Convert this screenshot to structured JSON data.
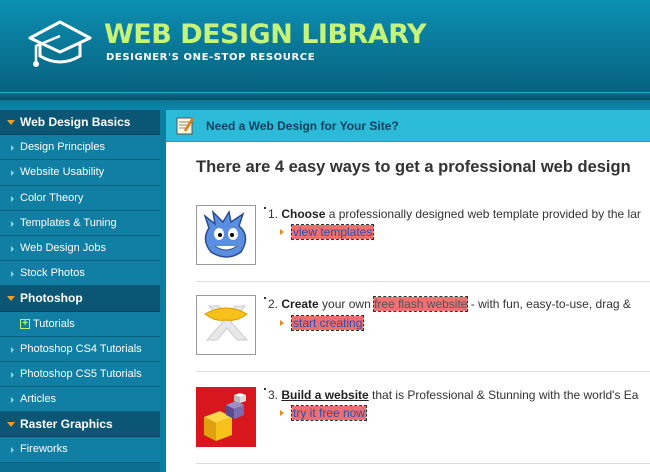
{
  "header": {
    "title": "WEB DESIGN LIBRARY",
    "tagline": "DESIGNER'S ONE-STOP RESOURCE"
  },
  "sidebar": {
    "sections": [
      {
        "label": "Web Design Basics",
        "items": [
          "Design Principles",
          "Website Usability",
          "Color Theory",
          "Templates & Tuning",
          "Web Design Jobs",
          "Stock Photos"
        ]
      },
      {
        "label": "Photoshop",
        "items": [
          "Tutorials",
          "Photoshop CS4 Tutorials",
          "Photoshop CS5 Tutorials",
          "Articles"
        ]
      },
      {
        "label": "Raster Graphics",
        "items": [
          "Fireworks"
        ]
      }
    ]
  },
  "banner": {
    "text": "Need a Web Design for Your Site?"
  },
  "main": {
    "heading": "There are 4 easy ways to get a professional web design",
    "steps": [
      {
        "num": "1.",
        "lead": "Choose",
        "rest": " a professionally designed web template provided by the lar",
        "cta": "view templates"
      },
      {
        "num": "2.",
        "lead": "Create",
        "mid": " your own ",
        "highlight": "free flash website",
        "rest": " - with fun, easy-to-use, drag &",
        "cta": "start creating"
      },
      {
        "num": "3.",
        "lead": "Build a website",
        "rest": " that is Professional & Stunning with the world's Ea",
        "cta": "try it free now"
      }
    ]
  },
  "colors": {
    "header": "#0a7898",
    "logo_title": "#c6f47a",
    "sidebar": "#117fa3",
    "sidebar_head": "#0a5674",
    "banner": "#2bbad8",
    "accent_orange": "#f29a22",
    "link_highlight": "#ee6e6e"
  },
  "icons": {
    "logo": "graduation-cap-icon",
    "banner": "notepad-pencil-icon",
    "step1": "blue-monster-icon",
    "step2": "wix-logo-icon",
    "step3": "3d-cubes-icon"
  }
}
